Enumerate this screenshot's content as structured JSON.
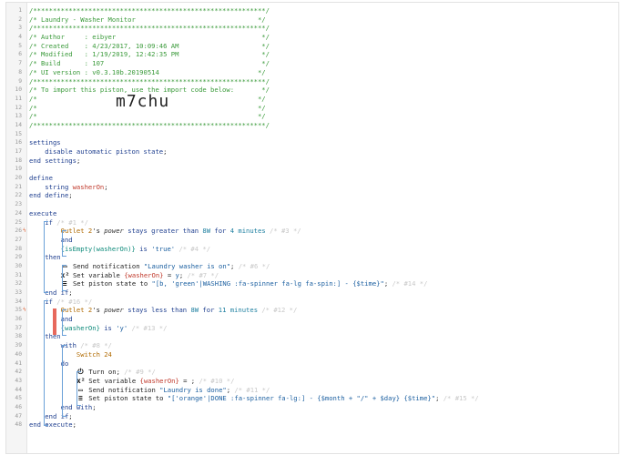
{
  "lines": [
    {
      "n": "1",
      "t": [
        {
          "c": "cmt",
          "v": "/***********************************************************/"
        }
      ]
    },
    {
      "n": "2",
      "t": [
        {
          "c": "cmt",
          "v": "/* Laundry - Washer Monitor                               */"
        }
      ]
    },
    {
      "n": "3",
      "t": [
        {
          "c": "cmt",
          "v": "/***********************************************************/"
        }
      ]
    },
    {
      "n": "4",
      "t": [
        {
          "c": "cmt",
          "v": "/* Author     : eibyer                                     */"
        }
      ]
    },
    {
      "n": "5",
      "t": [
        {
          "c": "cmt",
          "v": "/* Created    : 4/23/2017, 10:09:46 AM                     */"
        }
      ]
    },
    {
      "n": "6",
      "t": [
        {
          "c": "cmt",
          "v": "/* Modified   : 1/19/2019, 12:42:35 PM                     */"
        }
      ]
    },
    {
      "n": "7",
      "t": [
        {
          "c": "cmt",
          "v": "/* Build      : 107                                        */"
        }
      ]
    },
    {
      "n": "8",
      "t": [
        {
          "c": "cmt",
          "v": "/* UI version : v0.3.10b.20190514                         */"
        }
      ]
    },
    {
      "n": "9",
      "t": [
        {
          "c": "cmt",
          "v": "/***********************************************************/"
        }
      ]
    },
    {
      "n": "10",
      "t": [
        {
          "c": "cmt",
          "v": "/* To import this piston, use the import code below:       */"
        }
      ]
    },
    {
      "n": "11",
      "t": [
        {
          "c": "cmt",
          "v": "/*                                                        */"
        }
      ]
    },
    {
      "n": "12",
      "t": [
        {
          "c": "cmt",
          "v": "/*                                                        */"
        }
      ],
      "big": "m7chu"
    },
    {
      "n": "13",
      "t": [
        {
          "c": "cmt",
          "v": "/*                                                        */"
        }
      ]
    },
    {
      "n": "14",
      "t": [
        {
          "c": "cmt",
          "v": "/***********************************************************/"
        }
      ]
    },
    {
      "n": "15",
      "t": []
    },
    {
      "n": "16",
      "t": [
        {
          "c": "kw",
          "v": "settings"
        }
      ]
    },
    {
      "n": "17",
      "t": [
        {
          "c": "kw",
          "v": "    disable automatic piston state"
        },
        {
          "c": "op",
          "v": ";"
        }
      ]
    },
    {
      "n": "18",
      "t": [
        {
          "c": "kw",
          "v": "end settings"
        },
        {
          "c": "op",
          "v": ";"
        }
      ]
    },
    {
      "n": "19",
      "t": []
    },
    {
      "n": "20",
      "t": [
        {
          "c": "kw",
          "v": "define"
        }
      ]
    },
    {
      "n": "21",
      "t": [
        {
          "c": "kw",
          "v": "    string "
        },
        {
          "c": "var",
          "v": "washerOn"
        },
        {
          "c": "op",
          "v": ";"
        }
      ]
    },
    {
      "n": "22",
      "t": [
        {
          "c": "kw",
          "v": "end define"
        },
        {
          "c": "op",
          "v": ";"
        }
      ]
    },
    {
      "n": "23",
      "t": []
    },
    {
      "n": "24",
      "t": [
        {
          "c": "kw",
          "v": "execute"
        }
      ]
    },
    {
      "n": "25",
      "t": [
        {
          "c": "kw",
          "v": "    if "
        },
        {
          "c": "idx",
          "v": "/* #1 */"
        }
      ]
    },
    {
      "n": "26",
      "m": "ϟ",
      "t": [
        {
          "c": "dev",
          "v": "        Outlet 2"
        },
        {
          "c": "op",
          "v": "'s "
        },
        {
          "c": "attr",
          "v": "power"
        },
        {
          "c": "kw",
          "v": " stays greater than "
        },
        {
          "c": "num",
          "v": "8W"
        },
        {
          "c": "kw",
          "v": " for "
        },
        {
          "c": "num",
          "v": "4 minutes"
        },
        {
          "c": "idx",
          "v": " /* #3 */"
        }
      ]
    },
    {
      "n": "27",
      "t": [
        {
          "c": "kw",
          "v": "        and"
        }
      ]
    },
    {
      "n": "28",
      "t": [
        {
          "c": "fn",
          "v": "        {isEmpty(washerOn)}"
        },
        {
          "c": "kw",
          "v": " is "
        },
        {
          "c": "str",
          "v": "'true'"
        },
        {
          "c": "idx",
          "v": " /* #4 */"
        }
      ]
    },
    {
      "n": "29",
      "t": [
        {
          "c": "kw",
          "v": "    then"
        }
      ]
    },
    {
      "n": "30",
      "i": "▭",
      "t": [
        {
          "c": "op",
          "v": "          Send notification "
        },
        {
          "c": "str",
          "v": "\"Laundry washer is on\""
        },
        {
          "c": "op",
          "v": ";"
        },
        {
          "c": "idx",
          "v": " /* #6 */"
        }
      ]
    },
    {
      "n": "31",
      "i": "x²",
      "t": [
        {
          "c": "op",
          "v": "          Set variable "
        },
        {
          "c": "var",
          "v": "{washerOn}"
        },
        {
          "c": "op",
          "v": " = "
        },
        {
          "c": "str",
          "v": "y"
        },
        {
          "c": "op",
          "v": ";"
        },
        {
          "c": "idx",
          "v": " /* #7 */"
        }
      ]
    },
    {
      "n": "32",
      "i": "≡",
      "t": [
        {
          "c": "op",
          "v": "          Set piston state to "
        },
        {
          "c": "str",
          "v": "\"[b, 'green'|WASHING :fa-spinner fa-lg fa-spin:] - {$time}\""
        },
        {
          "c": "op",
          "v": ";"
        },
        {
          "c": "idx",
          "v": " /* #14 */"
        }
      ]
    },
    {
      "n": "33",
      "t": [
        {
          "c": "kw",
          "v": "    end if"
        },
        {
          "c": "op",
          "v": ";"
        }
      ]
    },
    {
      "n": "34",
      "t": [
        {
          "c": "kw",
          "v": "    if "
        },
        {
          "c": "idx",
          "v": "/* #16 */"
        }
      ]
    },
    {
      "n": "35",
      "m": "ϟ",
      "t": [
        {
          "c": "dev",
          "v": "        Outlet 2"
        },
        {
          "c": "op",
          "v": "'s "
        },
        {
          "c": "attr",
          "v": "power"
        },
        {
          "c": "kw",
          "v": " stays less than "
        },
        {
          "c": "num",
          "v": "8W"
        },
        {
          "c": "kw",
          "v": " for "
        },
        {
          "c": "num",
          "v": "11 minutes"
        },
        {
          "c": "idx",
          "v": " /* #12 */"
        }
      ]
    },
    {
      "n": "36",
      "t": [
        {
          "c": "kw",
          "v": "        and"
        }
      ]
    },
    {
      "n": "37",
      "t": [
        {
          "c": "fn",
          "v": "        {washerOn}"
        },
        {
          "c": "kw",
          "v": " is "
        },
        {
          "c": "str",
          "v": "'y'"
        },
        {
          "c": "idx",
          "v": " /* #13 */"
        }
      ]
    },
    {
      "n": "38",
      "t": [
        {
          "c": "kw",
          "v": "    then"
        }
      ]
    },
    {
      "n": "39",
      "t": [
        {
          "c": "kw",
          "v": "        with "
        },
        {
          "c": "idx",
          "v": "/* #8 */"
        }
      ]
    },
    {
      "n": "40",
      "t": [
        {
          "c": "dev",
          "v": "            Switch 24"
        }
      ]
    },
    {
      "n": "41",
      "t": [
        {
          "c": "kw",
          "v": "        do"
        }
      ]
    },
    {
      "n": "42",
      "i": "⏻",
      "t": [
        {
          "c": "op",
          "v": "              Turn on"
        },
        {
          "c": "op",
          "v": ";"
        },
        {
          "c": "idx",
          "v": " /* #9 */"
        }
      ]
    },
    {
      "n": "43",
      "i": "x²",
      "t": [
        {
          "c": "op",
          "v": "              Set variable "
        },
        {
          "c": "var",
          "v": "{washerOn}"
        },
        {
          "c": "op",
          "v": " = ;"
        },
        {
          "c": "idx",
          "v": " /* #10 */"
        }
      ]
    },
    {
      "n": "44",
      "i": "▭",
      "t": [
        {
          "c": "op",
          "v": "              Send notification "
        },
        {
          "c": "str",
          "v": "\"Laundry is done\""
        },
        {
          "c": "op",
          "v": ";"
        },
        {
          "c": "idx",
          "v": " /* #11 */"
        }
      ]
    },
    {
      "n": "45",
      "i": "≡",
      "t": [
        {
          "c": "op",
          "v": "              Set piston state to "
        },
        {
          "c": "str",
          "v": "\"['orange'|DONE :fa-spinner fa-lg:] - {$month + \"/\" + $day} {$time}\""
        },
        {
          "c": "op",
          "v": ";"
        },
        {
          "c": "idx",
          "v": " /* #15 */"
        }
      ]
    },
    {
      "n": "46",
      "t": [
        {
          "c": "kw",
          "v": "        end with"
        },
        {
          "c": "op",
          "v": ";"
        }
      ]
    },
    {
      "n": "47",
      "t": [
        {
          "c": "kw",
          "v": "    end if"
        },
        {
          "c": "op",
          "v": ";"
        }
      ]
    },
    {
      "n": "48",
      "t": [
        {
          "c": "kw",
          "v": "end execute"
        },
        {
          "c": "op",
          "v": ";"
        }
      ]
    }
  ]
}
